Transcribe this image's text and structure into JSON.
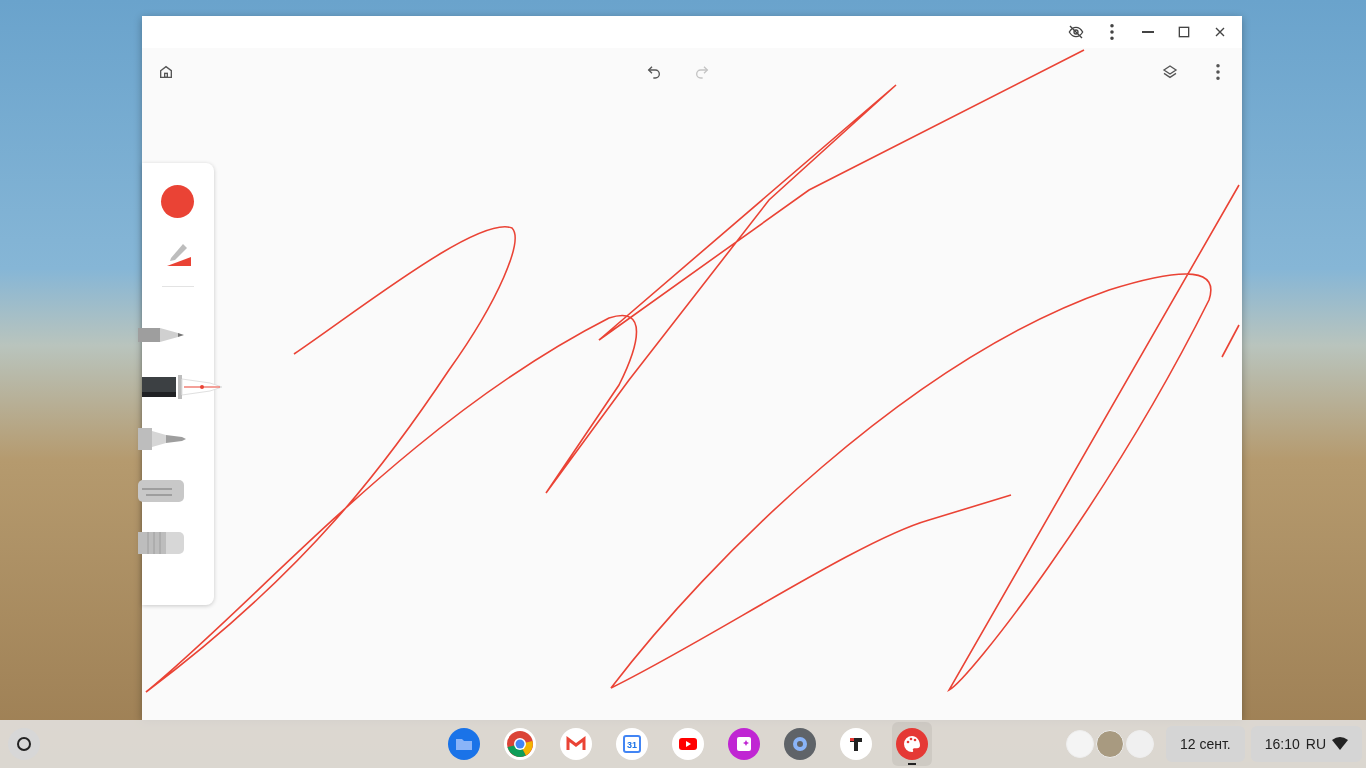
{
  "toolbar": {
    "undo_disabled": false,
    "redo_disabled": true
  },
  "palette": {
    "color": "#ea4335"
  },
  "tools": [
    {
      "kind": "pencil",
      "selected": false
    },
    {
      "kind": "pen",
      "selected": true
    },
    {
      "kind": "marker",
      "selected": false
    },
    {
      "kind": "chalk",
      "selected": false
    },
    {
      "kind": "eraser",
      "selected": false
    }
  ],
  "shelf": {
    "apps": [
      {
        "kind": "files",
        "active": false
      },
      {
        "kind": "browser",
        "active": false
      },
      {
        "kind": "mail",
        "active": false
      },
      {
        "kind": "calendar",
        "active": false,
        "label": "31"
      },
      {
        "kind": "video",
        "active": false
      },
      {
        "kind": "screencast",
        "active": false
      },
      {
        "kind": "settings",
        "active": false
      },
      {
        "kind": "text",
        "active": false
      },
      {
        "kind": "paint",
        "active": true
      }
    ]
  },
  "tray": {
    "date": "12 сент.",
    "time": "16:10",
    "language": "RU"
  }
}
